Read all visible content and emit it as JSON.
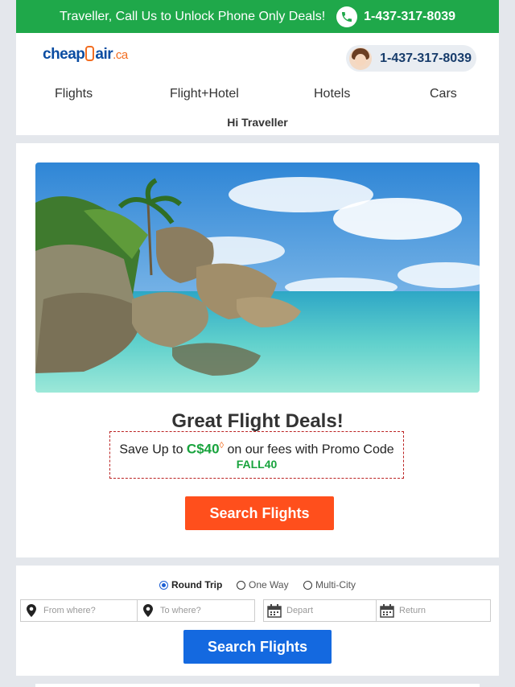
{
  "banner": {
    "text": "Traveller, Call Us to Unlock Phone Only Deals!",
    "phone": "1-437-317-8039"
  },
  "header": {
    "logo": {
      "part1": "cheap",
      "part2": "air",
      "suffix": ".ca"
    },
    "agent_phone": "1-437-317-8039",
    "nav": [
      "Flights",
      "Flight+Hotel",
      "Hotels",
      "Cars"
    ],
    "greeting": "Hi Traveller"
  },
  "promo": {
    "title": "Great Flight Deals!",
    "deal_prefix": "Save Up to",
    "deal_amount": "C$40",
    "deal_mark": "◊",
    "deal_suffix": "on our fees with Promo Code",
    "promo_code": "FALL40",
    "button": "Search Flights"
  },
  "search": {
    "trip_types": [
      "Round Trip",
      "One Way",
      "Multi-City"
    ],
    "selected_trip": "Round Trip",
    "from_placeholder": "From where?",
    "to_placeholder": "To where?",
    "depart_placeholder": "Depart",
    "return_placeholder": "Return",
    "button": "Search Flights"
  },
  "colors": {
    "banner_green": "#1fa84a",
    "orange_cta": "#ff4f1c",
    "blue_cta": "#1469e0",
    "deal_green": "#18a33d"
  }
}
